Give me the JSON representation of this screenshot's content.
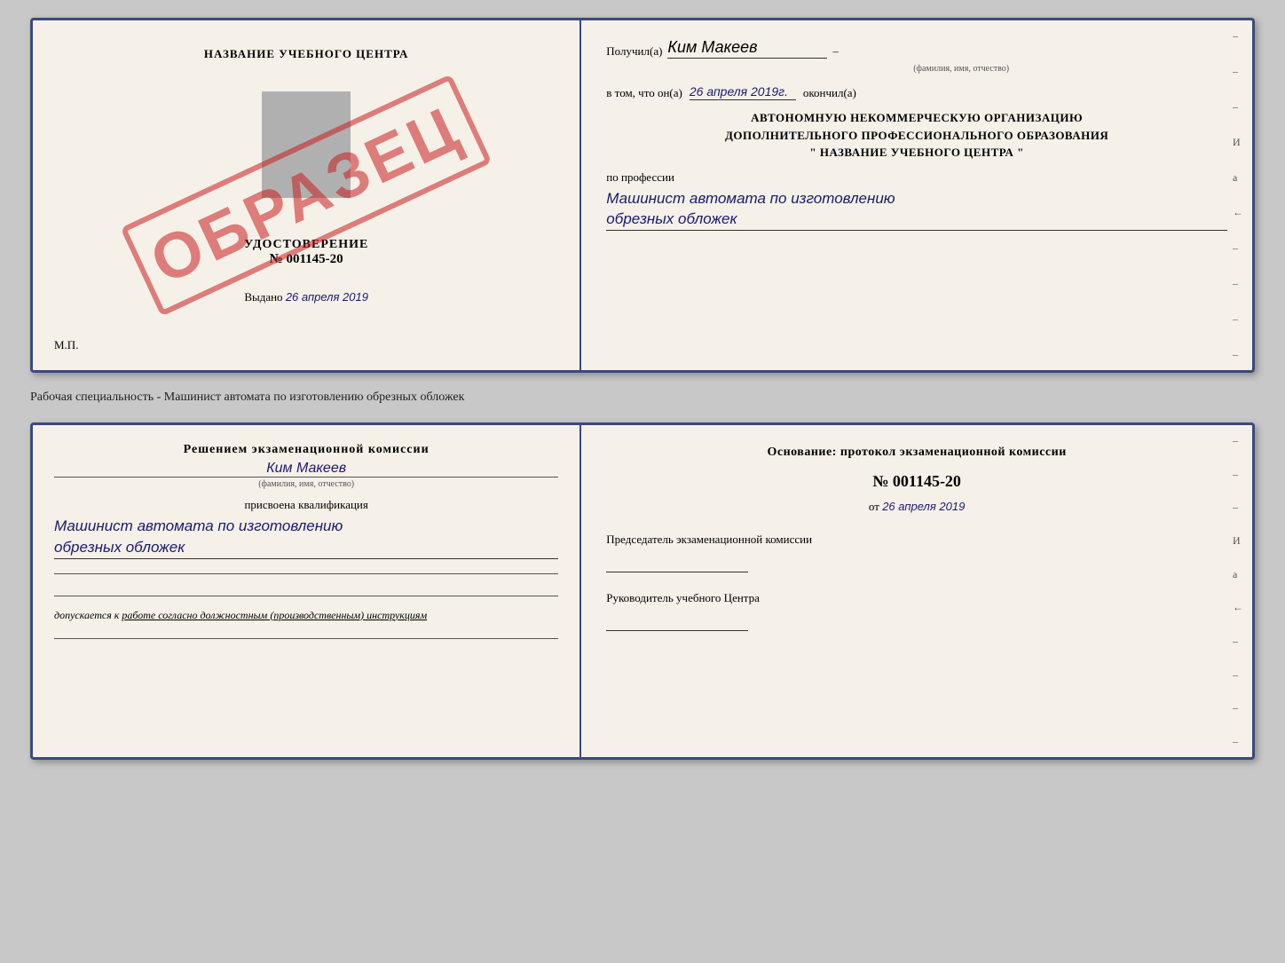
{
  "top_card": {
    "left": {
      "school_name": "НАЗВАНИЕ УЧЕБНОГО ЦЕНТРА",
      "cert_title": "УДОСТОВЕРЕНИЕ",
      "cert_number": "№ 001145-20",
      "issued_label": "Выдано",
      "issued_date": "26 апреля 2019",
      "mp_label": "М.П.",
      "watermark": "ОБРАЗЕЦ"
    },
    "right": {
      "received_label": "Получил(а)",
      "received_name": "Ким Макеев",
      "name_subtext": "(фамилия, имя, отчество)",
      "in_that_label": "в том, что он(а)",
      "date_value": "26 апреля 2019г.",
      "finished_label": "окончил(а)",
      "org_block_line1": "АВТОНОМНУЮ НЕКОММЕРЧЕСКУЮ ОРГАНИЗАЦИЮ",
      "org_block_line2": "ДОПОЛНИТЕЛЬНОГО ПРОФЕССИОНАЛЬНОГО ОБРАЗОВАНИЯ",
      "org_block_line3": "\"   НАЗВАНИЕ УЧЕБНОГО ЦЕНТРА   \"",
      "profession_label": "по профессии",
      "profession_line1": "Машинист автомата по изготовлению",
      "profession_line2": "обрезных обложек",
      "right_dashes": [
        "-",
        "-",
        "-",
        "И",
        "а",
        "←",
        "-",
        "-",
        "-",
        "-"
      ]
    }
  },
  "separator": {
    "text": "Рабочая специальность - Машинист автомата по изготовлению обрезных обложек"
  },
  "bottom_card": {
    "left": {
      "decision_text": "Решением экзаменационной комиссии",
      "person_name": "Ким Макеев",
      "name_subtext": "(фамилия, имя, отчество)",
      "qualification_label": "присвоена квалификация",
      "qualification_line1": "Машинист автомата по изготовлению",
      "qualification_line2": "обрезных обложек",
      "admits_label": "допускается к",
      "admits_value": "работе согласно должностным (производственным) инструкциям"
    },
    "right": {
      "basis_text": "Основание: протокол экзаменационной комиссии",
      "protocol_number": "№  001145-20",
      "protocol_date_prefix": "от",
      "protocol_date": "26 апреля 2019",
      "chairman_label": "Председатель экзаменационной комиссии",
      "head_label": "Руководитель учебного Центра",
      "right_dashes": [
        "-",
        "-",
        "-",
        "И",
        "а",
        "←",
        "-",
        "-",
        "-",
        "-"
      ]
    }
  }
}
